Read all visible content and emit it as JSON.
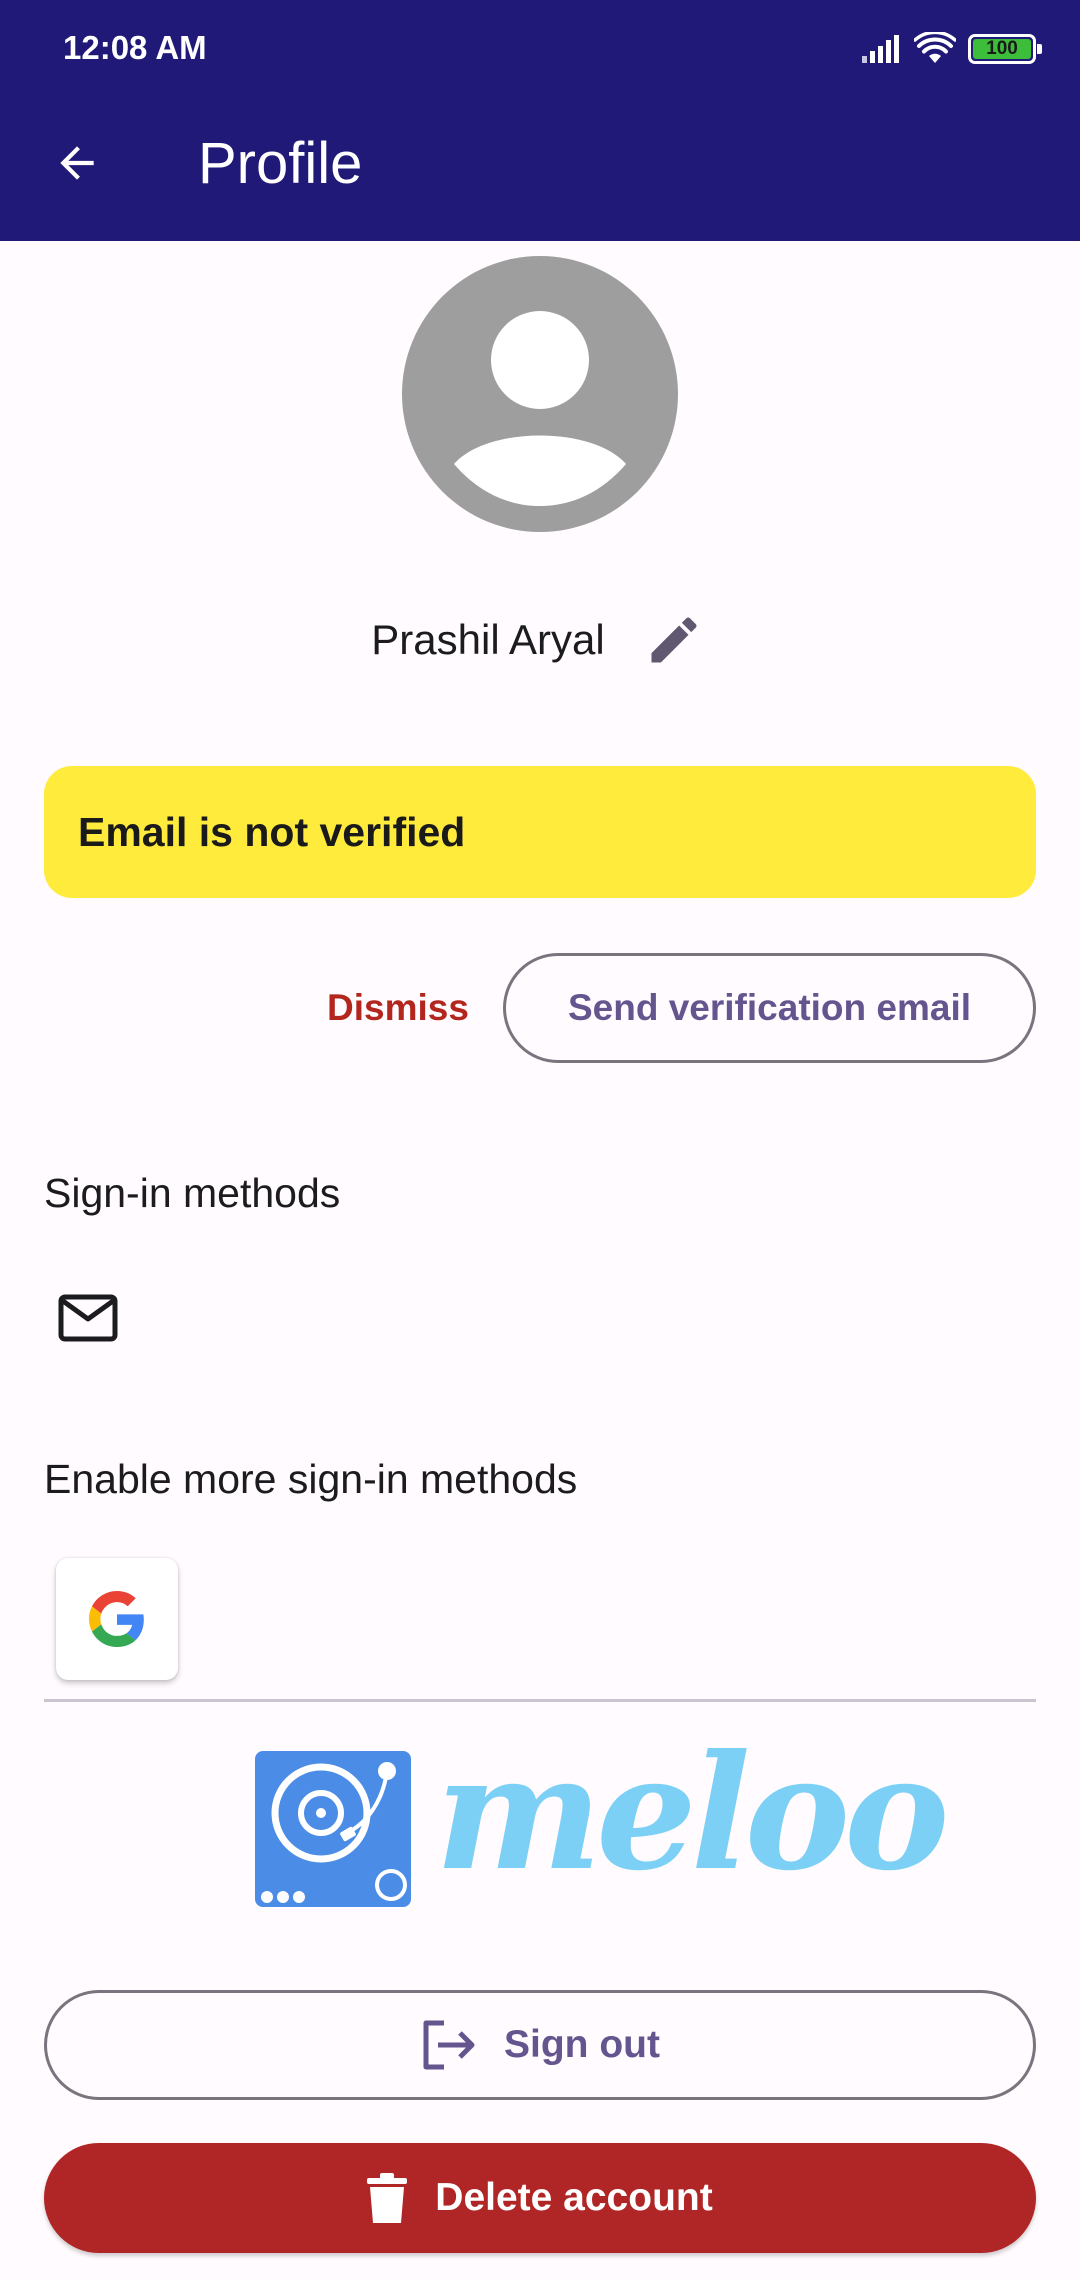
{
  "status_bar": {
    "time": "12:08 AM",
    "battery_level": "100",
    "icons": [
      "signal-icon",
      "wifi-icon",
      "battery-icon"
    ]
  },
  "app_bar": {
    "title": "Profile",
    "back_icon": "arrow-back-icon"
  },
  "profile": {
    "avatar_icon": "account-circle-icon",
    "name": "Prashil Aryal",
    "edit_icon": "pencil-icon"
  },
  "verification": {
    "banner_text": "Email is not verified",
    "dismiss_label": "Dismiss",
    "send_label": "Send verification email"
  },
  "sign_in": {
    "title": "Sign-in methods",
    "methods": [
      "mail-icon"
    ]
  },
  "more_sign_in": {
    "title": "Enable more sign-in methods",
    "providers": [
      "google-icon"
    ]
  },
  "brand": {
    "wordmark": "meloo"
  },
  "actions": {
    "sign_out_label": "Sign out",
    "delete_label": "Delete account"
  },
  "colors": {
    "app_bar": "#211977",
    "banner": "#FFEB3B",
    "danger": "#B02626",
    "primary": "#65558F",
    "brand_tile": "#4A8CE6",
    "brand_word": "#7DD0F5"
  }
}
